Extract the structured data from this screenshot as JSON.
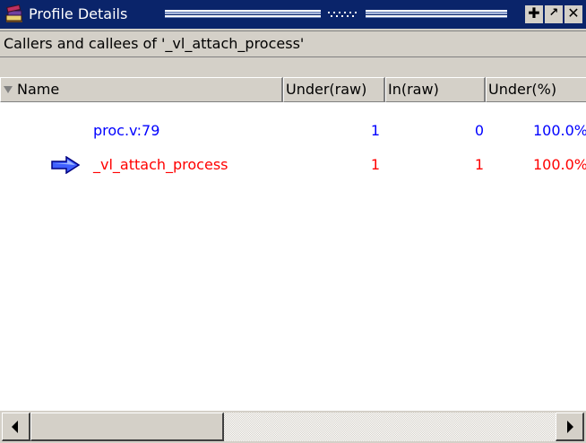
{
  "window": {
    "title": "Profile Details",
    "icon": "books-icon",
    "buttons": {
      "pin": "✚",
      "restore": "↗",
      "close": "✕"
    },
    "colors": {
      "titlebar": "#0a246a",
      "caller_text": "#0000ff",
      "current_text": "#ff0000"
    }
  },
  "caption": "Callers and callees of '_vl_attach_process'",
  "columns": {
    "name": "Name",
    "under_raw": "Under(raw)",
    "in_raw": "In(raw)",
    "under_pct": "Under(%)"
  },
  "rows": [
    {
      "name": "proc.v:79",
      "under_raw": "1",
      "in_raw": "0",
      "under_pct": "100.0%",
      "current": false
    },
    {
      "name": "_vl_attach_process",
      "under_raw": "1",
      "in_raw": "1",
      "under_pct": "100.0%",
      "current": true,
      "icon": "right-arrow-icon"
    }
  ]
}
